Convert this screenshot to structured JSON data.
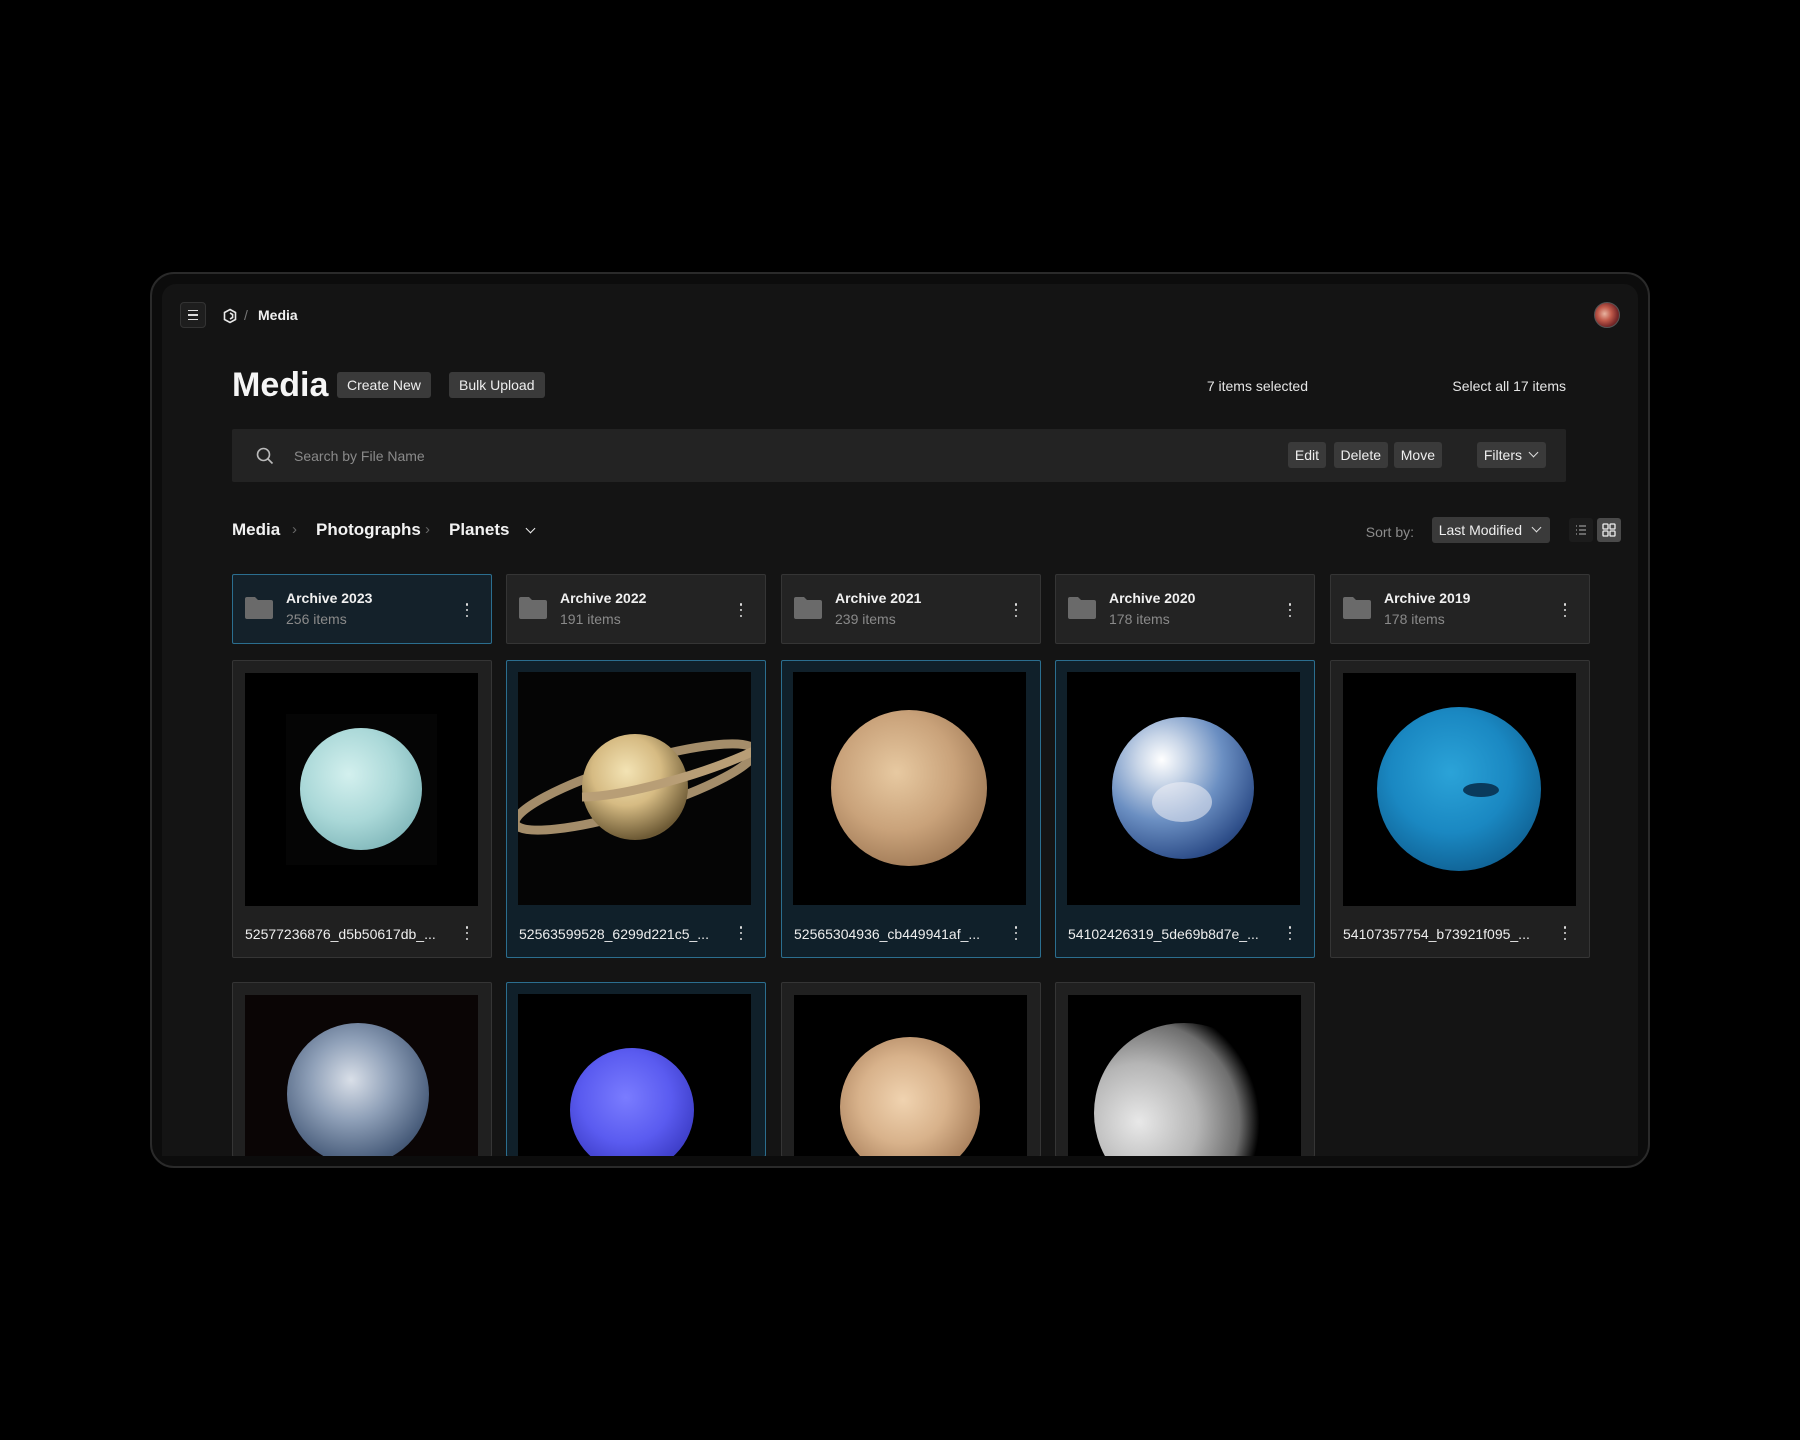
{
  "topbar": {
    "breadcrumb": "Media"
  },
  "header": {
    "title": "Media",
    "create_label": "Create New",
    "bulk_label": "Bulk Upload",
    "selection_status": "7 items selected",
    "select_all_label": "Select all 17 items"
  },
  "search": {
    "placeholder": "Search by File Name",
    "edit_label": "Edit",
    "delete_label": "Delete",
    "move_label": "Move",
    "filters_label": "Filters"
  },
  "breadcrumbs": [
    "Media",
    "Photographs",
    "Planets"
  ],
  "sort": {
    "label": "Sort by:",
    "value": "Last Modified",
    "view_mode": "grid"
  },
  "folders": [
    {
      "name": "Archive 2023",
      "count": "256 items",
      "selected": true
    },
    {
      "name": "Archive 2022",
      "count": "191 items",
      "selected": false
    },
    {
      "name": "Archive 2021",
      "count": "239 items",
      "selected": false
    },
    {
      "name": "Archive 2020",
      "count": "178 items",
      "selected": false
    },
    {
      "name": "Archive 2019",
      "count": "178 items",
      "selected": false
    }
  ],
  "files": [
    {
      "name": "52577236876_d5b50617db_...",
      "subject": "uranus",
      "selected": false
    },
    {
      "name": "52563599528_6299d221c5_...",
      "subject": "saturn",
      "selected": true
    },
    {
      "name": "52565304936_cb449941af_...",
      "subject": "mars",
      "selected": true
    },
    {
      "name": "54102426319_5de69b8d7e_...",
      "subject": "earth",
      "selected": true
    },
    {
      "name": "54107357754_b73921f095_...",
      "subject": "neptune",
      "selected": false
    },
    {
      "name": "",
      "subject": "venus",
      "selected": false
    },
    {
      "name": "",
      "subject": "neptune-violet",
      "selected": true
    },
    {
      "name": "",
      "subject": "pluto",
      "selected": false
    },
    {
      "name": "",
      "subject": "moon",
      "selected": false
    }
  ],
  "colors": {
    "selection_border": "#2b6e8f",
    "background": "#141414"
  }
}
